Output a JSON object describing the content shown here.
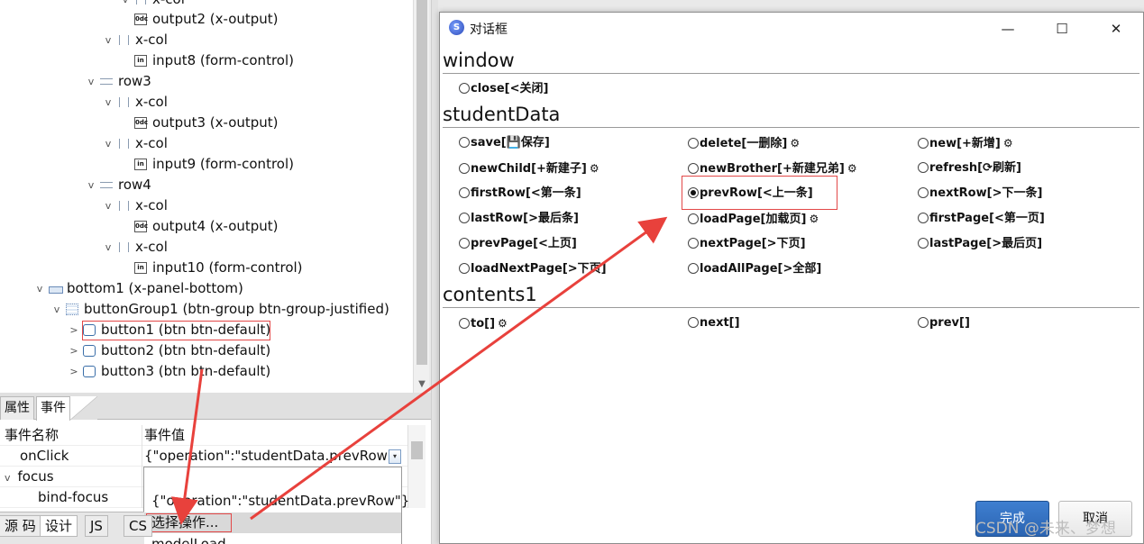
{
  "outline": {
    "nodes": [
      {
        "label": "x-col",
        "icon": "col-icon",
        "twisty": "v"
      },
      {
        "label": "output2 (x-output)",
        "icon": "output-icon",
        "twisty": ""
      },
      {
        "label": "x-col",
        "icon": "col-icon",
        "twisty": "v"
      },
      {
        "label": "input8 (form-control)",
        "icon": "input-icon",
        "twisty": ""
      },
      {
        "label": "row3",
        "icon": "row-icon",
        "twisty": "v"
      },
      {
        "label": "x-col",
        "icon": "col-icon",
        "twisty": "v"
      },
      {
        "label": "output3 (x-output)",
        "icon": "output-icon",
        "twisty": ""
      },
      {
        "label": "x-col",
        "icon": "col-icon",
        "twisty": "v"
      },
      {
        "label": "input9 (form-control)",
        "icon": "input-icon",
        "twisty": ""
      },
      {
        "label": "row4",
        "icon": "row-icon",
        "twisty": "v"
      },
      {
        "label": "x-col",
        "icon": "col-icon",
        "twisty": "v"
      },
      {
        "label": "output4 (x-output)",
        "icon": "output-icon",
        "twisty": ""
      },
      {
        "label": "x-col",
        "icon": "col-icon",
        "twisty": "v"
      },
      {
        "label": "input10 (form-control)",
        "icon": "input-icon",
        "twisty": ""
      },
      {
        "label": "bottom1 (x-panel-bottom)",
        "icon": "panel-icon",
        "twisty": "v"
      },
      {
        "label": "buttonGroup1 (btn-group btn-group-justified)",
        "icon": "button-group-icon",
        "twisty": "v"
      },
      {
        "label": "button1 (btn btn-default)",
        "icon": "button-icon",
        "twisty": ">"
      },
      {
        "label": "button2 (btn btn-default)",
        "icon": "button-icon",
        "twisty": ">"
      },
      {
        "label": "button3 (btn btn-default)",
        "icon": "button-icon",
        "twisty": ">"
      }
    ],
    "icon_text": {
      "output": "0dc",
      "input": "in"
    }
  },
  "props": {
    "tab_properties": "属性",
    "tab_events": "事件",
    "header_name": "事件名称",
    "header_value": "事件值",
    "rows": [
      {
        "name": "onClick",
        "value": "{\"operation\":\"studentData.prevRow\"}"
      },
      {
        "name": "focus",
        "value": ""
      },
      {
        "name": "bind-focus",
        "value": ""
      }
    ],
    "combo_arrow": "▾",
    "focus_twisty": "v"
  },
  "dropdown": {
    "items": [
      "{\"operation\":\"studentData.prevRow\"}",
      "选择操作...",
      "modelLoad"
    ]
  },
  "editor_tabs": [
    "源 码",
    "设计",
    "JS",
    "CS"
  ],
  "dialog": {
    "title": "对话框",
    "app_icon": "S",
    "min": "—",
    "max": "☐",
    "close": "✕",
    "sections": [
      {
        "title": "window",
        "options": [
          {
            "label": "close[<关闭]",
            "gear": false,
            "checked": false
          }
        ]
      },
      {
        "title": "studentData",
        "options": [
          {
            "label": "save[💾保存]",
            "gear": false,
            "checked": false
          },
          {
            "label": "delete[一删除]",
            "gear": true,
            "checked": false
          },
          {
            "label": "new[+新增]",
            "gear": true,
            "checked": false
          },
          {
            "label": "newChild[+新建子]",
            "gear": true,
            "checked": false
          },
          {
            "label": "newBrother[+新建兄弟]",
            "gear": true,
            "checked": false
          },
          {
            "label": "refresh[⟳刷新]",
            "gear": false,
            "checked": false
          },
          {
            "label": "firstRow[<第一条]",
            "gear": false,
            "checked": false
          },
          {
            "label": "prevRow[<上一条]",
            "gear": false,
            "checked": true
          },
          {
            "label": "nextRow[>下一条]",
            "gear": false,
            "checked": false
          },
          {
            "label": "lastRow[>最后条]",
            "gear": false,
            "checked": false
          },
          {
            "label": "loadPage[加载页]",
            "gear": true,
            "checked": false
          },
          {
            "label": "firstPage[<第一页]",
            "gear": false,
            "checked": false
          },
          {
            "label": "prevPage[<上页]",
            "gear": false,
            "checked": false
          },
          {
            "label": "nextPage[>下页]",
            "gear": false,
            "checked": false
          },
          {
            "label": "lastPage[>最后页]",
            "gear": false,
            "checked": false
          },
          {
            "label": "loadNextPage[>下页]",
            "gear": false,
            "checked": false
          },
          {
            "label": "loadAllPage[>全部]",
            "gear": false,
            "checked": false
          }
        ]
      },
      {
        "title": "contents1",
        "options": [
          {
            "label": "to[]",
            "gear": true,
            "checked": false
          },
          {
            "label": "next[]",
            "gear": false,
            "checked": false
          },
          {
            "label": "prev[]",
            "gear": false,
            "checked": false
          }
        ]
      }
    ],
    "ok_label": "完成",
    "cancel_label": "取消"
  },
  "watermark": "CSDN @未来、梦想",
  "colors": {
    "highlight": "#e34848",
    "accent": "#2b64b2",
    "arrow": "#e8413c"
  }
}
